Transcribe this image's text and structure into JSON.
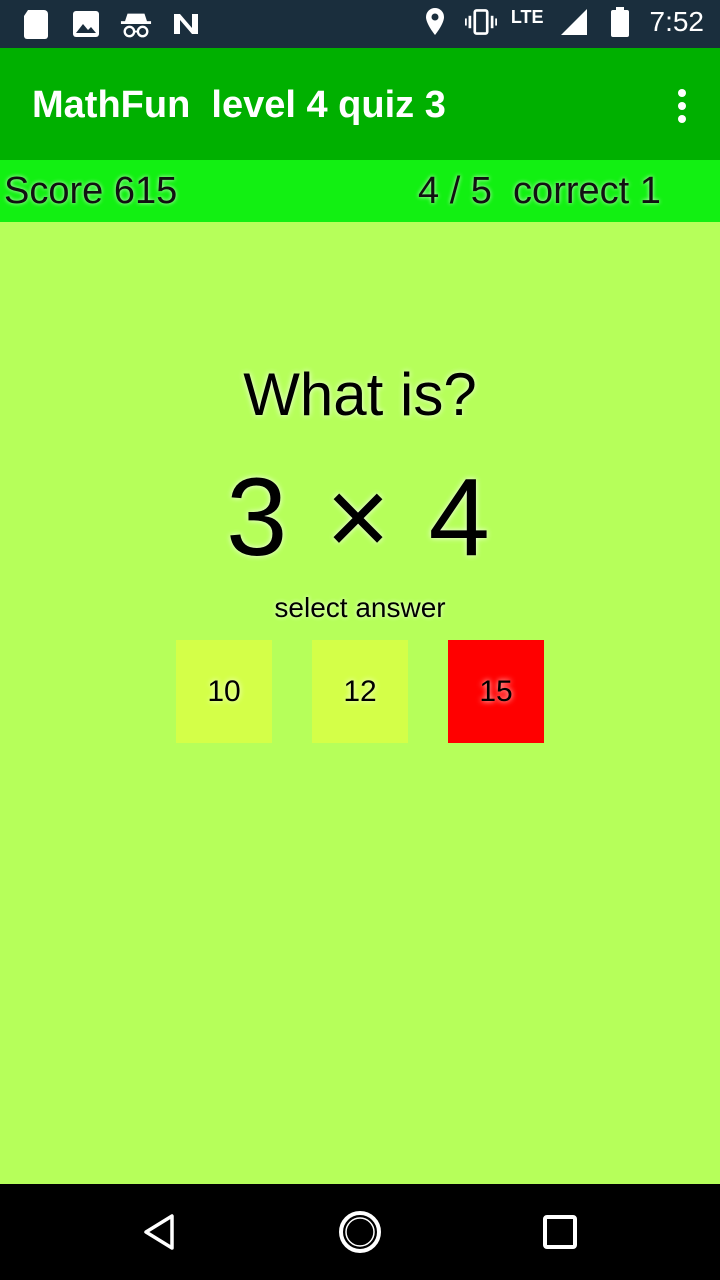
{
  "status_bar": {
    "network": "LTE",
    "time": "7:52",
    "left_icons": [
      "sd-card-icon",
      "image-icon",
      "incognito-icon",
      "n-icon"
    ],
    "right_icons": [
      "location-icon",
      "vibrate-icon",
      "signal-icon",
      "battery-icon"
    ]
  },
  "app_bar": {
    "title": "MathFun  level 4 quiz 3",
    "background": "#00b000"
  },
  "score_bar": {
    "score": "Score 615",
    "progress": "4 / 5  correct 1",
    "background": "#12f012"
  },
  "question": {
    "prompt": "What is?",
    "expression": "3 × 4",
    "instruction": "select answer"
  },
  "answers": [
    {
      "label": "10",
      "color": "#d4ff48"
    },
    {
      "label": "12",
      "color": "#d4ff48"
    },
    {
      "label": "15",
      "color": "#ff0000"
    }
  ],
  "nav_bar": {
    "icons": [
      "back-icon",
      "home-icon",
      "recents-icon"
    ]
  },
  "colors": {
    "page_background": "#b6ff5a",
    "status_bar": "#1a2e3d"
  }
}
